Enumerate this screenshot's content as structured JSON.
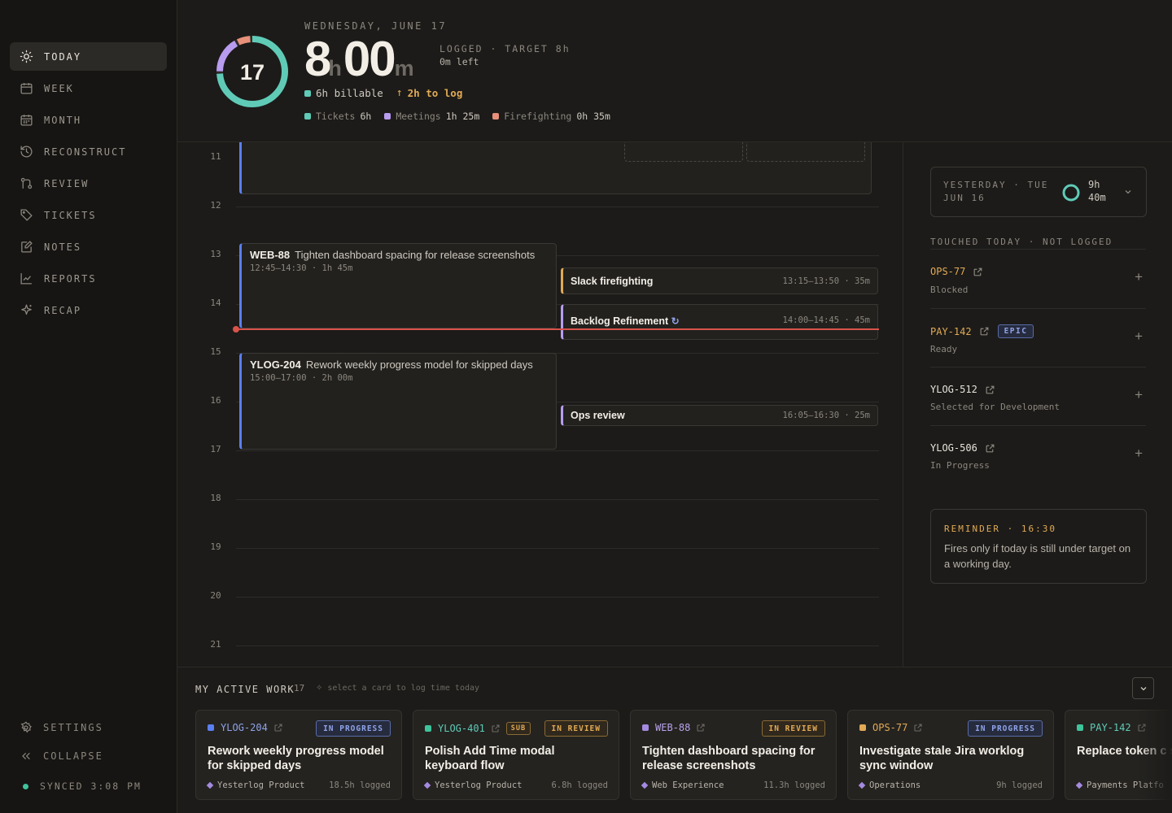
{
  "nav": {
    "items": [
      {
        "label": "TODAY",
        "icon": "sun-icon"
      },
      {
        "label": "WEEK",
        "icon": "calendar-icon"
      },
      {
        "label": "MONTH",
        "icon": "calendar-grid-icon"
      },
      {
        "label": "RECONSTRUCT",
        "icon": "history-icon"
      },
      {
        "label": "REVIEW",
        "icon": "git-compare-icon"
      },
      {
        "label": "TICKETS",
        "icon": "tag-icon"
      },
      {
        "label": "NOTES",
        "icon": "note-edit-icon"
      },
      {
        "label": "REPORTS",
        "icon": "chart-line-icon"
      },
      {
        "label": "RECAP",
        "icon": "sparkle-icon"
      }
    ],
    "settings": "SETTINGS",
    "collapse": "COLLAPSE",
    "sync": "SYNCED 3:08 PM"
  },
  "header": {
    "date": "WEDNESDAY, JUNE 17",
    "day_number": "17",
    "hours": "8",
    "h_unit": "h",
    "minutes": "00",
    "m_unit": "m",
    "logged_label": "LOGGED · TARGET 8h",
    "left_label": "0m left",
    "billable": "6h billable",
    "to_log": "2h to log",
    "breakdown": [
      {
        "label": "Tickets",
        "value": "6h",
        "color": "#5fcbb7"
      },
      {
        "label": "Meetings",
        "value": "1h 25m",
        "color": "#b89cf0"
      },
      {
        "label": "Firefighting",
        "value": "0h 35m",
        "color": "#e8907a"
      }
    ],
    "ring_fraction": {
      "tickets": 0.75,
      "meetings": 0.177,
      "firefighting": 0.073
    }
  },
  "timeline": {
    "hours": [
      "11",
      "12",
      "13",
      "14",
      "15",
      "16",
      "17",
      "18",
      "19",
      "20",
      "21"
    ],
    "blocks": [
      {
        "key": "WEB-88",
        "title": "Tighten dashboard spacing for release screenshots",
        "sub": "12:45–14:30 · 1h 45m"
      },
      {
        "key": "YLOG-204",
        "title": "Rework weekly progress model for skipped days",
        "sub": "15:00–17:00 · 2h 00m"
      }
    ],
    "meetings": [
      {
        "name": "Slack firefighting",
        "range": "13:15–13:50 · 35m",
        "color": "#e2aa55"
      },
      {
        "name": "Backlog Refinement",
        "range": "14:00–14:45 · 45m",
        "color": "#b89cf0"
      },
      {
        "name": "Ops review",
        "range": "16:05–16:30 · 25m",
        "color": "#b89cf0"
      }
    ]
  },
  "yesterday": {
    "label": "YESTERDAY · TUE",
    "date": "JUN 16",
    "hours": "9h",
    "minutes": "40m"
  },
  "touched": {
    "title": "TOUCHED TODAY · NOT LOGGED",
    "items": [
      {
        "key": "OPS-77",
        "status": "Blocked",
        "badge": "",
        "color": "#e2aa55"
      },
      {
        "key": "PAY-142",
        "status": "Ready",
        "badge": "EPIC",
        "color": "#e2aa55"
      },
      {
        "key": "YLOG-512",
        "status": "Selected for Development",
        "badge": "",
        "color": "#e8e4dc"
      },
      {
        "key": "YLOG-506",
        "status": "In Progress",
        "badge": "",
        "color": "#e8e4dc"
      }
    ]
  },
  "reminder": {
    "title": "REMINDER · 16:30",
    "text": "Fires only if today is still under target on a working day."
  },
  "active_work": {
    "title": "MY ACTIVE WORK",
    "count": "17",
    "hint": "select a card to log time today",
    "cards": [
      {
        "key": "YLOG-204",
        "sub": "",
        "badge": "IN PROGRESS",
        "title": "Rework weekly progress model for skipped days",
        "project": "Yesterlog Product",
        "logged": "18.5h logged",
        "color": "#5b7ff0"
      },
      {
        "key": "YLOG-401",
        "sub": "SUB",
        "badge": "IN REVIEW",
        "title": "Polish Add Time modal keyboard flow",
        "project": "Yesterlog Product",
        "logged": "6.8h logged",
        "color": "#3fc39a"
      },
      {
        "key": "WEB-88",
        "sub": "",
        "badge": "IN REVIEW",
        "title": "Tighten dashboard spacing for release screenshots",
        "project": "Web Experience",
        "logged": "11.3h logged",
        "color": "#a48ae0"
      },
      {
        "key": "OPS-77",
        "sub": "",
        "badge": "IN PROGRESS",
        "title": "Investigate stale Jira worklog sync window",
        "project": "Operations",
        "logged": "9h logged",
        "color": "#e2aa55"
      },
      {
        "key": "PAY-142",
        "sub": "",
        "badge": "",
        "title": "Replace token c settings",
        "project": "Payments Platfo",
        "logged": "",
        "color": "#3fc39a"
      }
    ]
  }
}
